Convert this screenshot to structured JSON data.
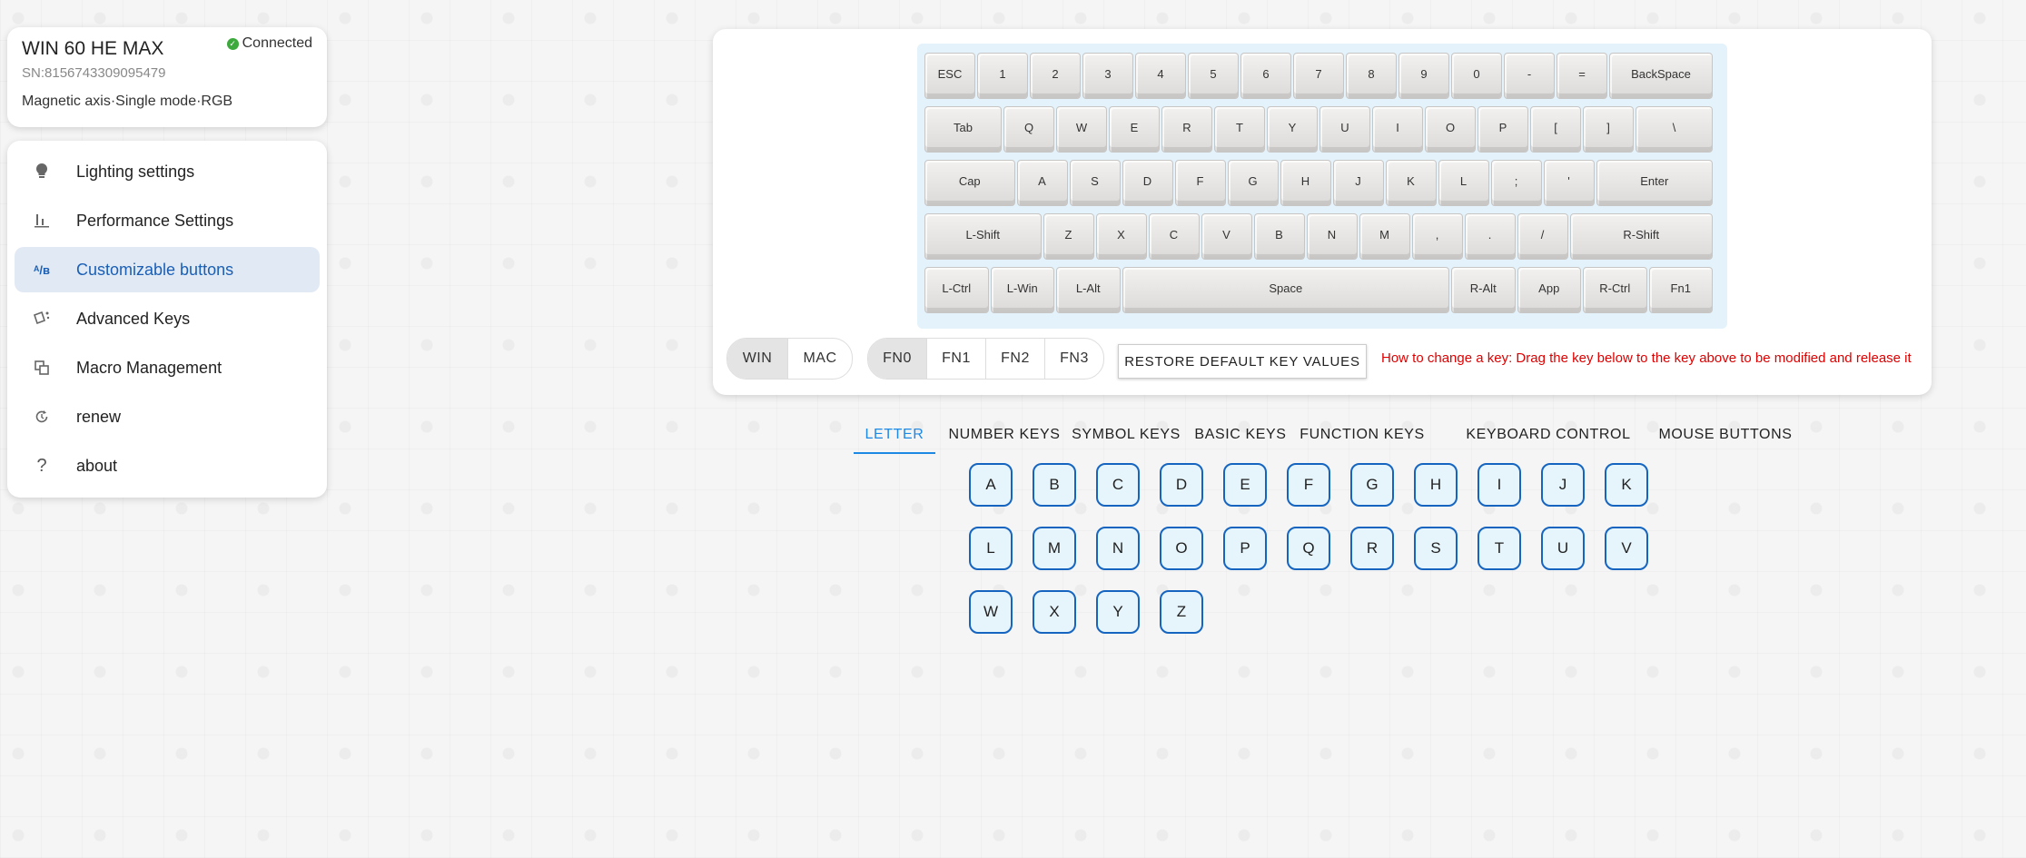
{
  "device": {
    "name": "WIN 60 HE MAX",
    "status": "Connected",
    "sn": "SN:8156743309095479",
    "description": "Magnetic axis·Single mode·RGB"
  },
  "nav": {
    "items": [
      {
        "label": "Lighting settings",
        "icon": "bulb-icon"
      },
      {
        "label": "Performance Settings",
        "icon": "bar-chart-icon"
      },
      {
        "label": "Customizable buttons",
        "icon": "remap-icon"
      },
      {
        "label": "Advanced Keys",
        "icon": "advanced-keys-icon"
      },
      {
        "label": "Macro Management",
        "icon": "macro-icon"
      },
      {
        "label": "renew",
        "icon": "refresh-icon"
      },
      {
        "label": "about",
        "icon": "help-icon"
      }
    ]
  },
  "keyboard": {
    "rows": [
      [
        "ESC",
        "1",
        "2",
        "3",
        "4",
        "5",
        "6",
        "7",
        "8",
        "9",
        "0",
        "-",
        "=",
        "BackSpace"
      ],
      [
        "Tab",
        "Q",
        "W",
        "E",
        "R",
        "T",
        "Y",
        "U",
        "I",
        "O",
        "P",
        "[",
        "]",
        "\\"
      ],
      [
        "Cap",
        "A",
        "S",
        "D",
        "F",
        "G",
        "H",
        "J",
        "K",
        "L",
        ";",
        "'",
        "Enter"
      ],
      [
        "L-Shift",
        "Z",
        "X",
        "C",
        "V",
        "B",
        "N",
        "M",
        ",",
        ".",
        "/",
        "R-Shift"
      ],
      [
        "L-Ctrl",
        "L-Win",
        "L-Alt",
        "Space",
        "R-Alt",
        "App",
        "R-Ctrl",
        "Fn1"
      ]
    ]
  },
  "os_toggle": {
    "options": [
      "WIN",
      "MAC"
    ],
    "selected": "WIN"
  },
  "layer_toggle": {
    "options": [
      "FN0",
      "FN1",
      "FN2",
      "FN3"
    ],
    "selected": "FN0"
  },
  "restore_label": "RESTORE DEFAULT KEY VALUES",
  "hint": "How to change a key: Drag the key below to the key above to be modified and release it",
  "tabs": [
    "LETTER",
    "NUMBER KEYS",
    "SYMBOL KEYS",
    "BASIC KEYS",
    "FUNCTION KEYS",
    "KEYBOARD CONTROL",
    "MOUSE BUTTONS"
  ],
  "active_tab": "LETTER",
  "letters": [
    "A",
    "B",
    "C",
    "D",
    "E",
    "F",
    "G",
    "H",
    "I",
    "J",
    "K",
    "L",
    "M",
    "N",
    "O",
    "P",
    "Q",
    "R",
    "S",
    "T",
    "U",
    "V",
    "W",
    "X",
    "Y",
    "Z"
  ],
  "colors": {
    "accent": "#1e88e5",
    "hint": "#e00000",
    "status": "#3ca93c"
  }
}
